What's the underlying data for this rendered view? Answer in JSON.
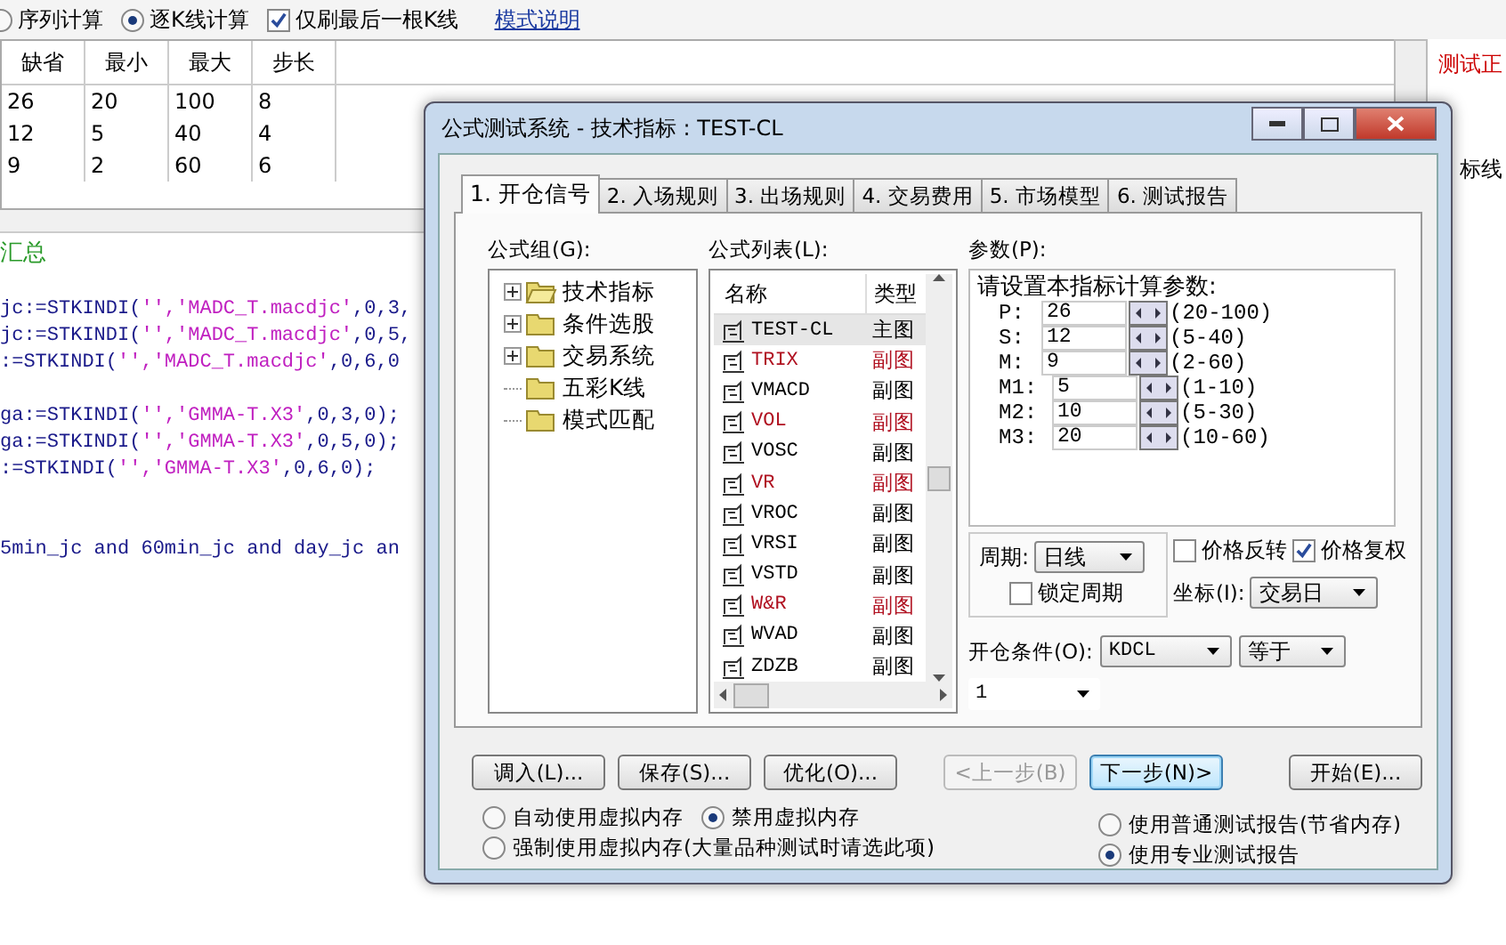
{
  "top_bar": {
    "modes": [
      {
        "label": "序列计算",
        "selected": false
      },
      {
        "label": "逐K线计算",
        "selected": true
      }
    ],
    "refresh_last": {
      "label": "仅刷最后一根K线",
      "checked": true
    },
    "link": "模式说明"
  },
  "param_table": {
    "columns": [
      "缺省",
      "最小",
      "最大",
      "步长"
    ],
    "rows": [
      [
        "26",
        "20",
        "100",
        "8"
      ],
      [
        "12",
        "5",
        "40",
        "4"
      ],
      [
        "9",
        "2",
        "60",
        "6"
      ]
    ]
  },
  "side_labels": [
    {
      "text": "测试正",
      "color": "#cc0000"
    },
    {
      "text": "标线",
      "color": "#000000"
    }
  ],
  "editor": {
    "heading": "汇总",
    "lines": [
      {
        "kind": "blank"
      },
      {
        "kind": "code",
        "parts": [
          {
            "kind": "code",
            "text": "jc:=STKINDI("
          },
          {
            "kind": "string",
            "text": "'','MADC_T.macdjc'"
          },
          {
            "kind": "code",
            "text": ",0,3,"
          }
        ]
      },
      {
        "kind": "code",
        "parts": [
          {
            "kind": "code",
            "text": "jc:=STKINDI("
          },
          {
            "kind": "string",
            "text": "'','MADC_T.macdjc'"
          },
          {
            "kind": "code",
            "text": ",0,5,"
          }
        ]
      },
      {
        "kind": "code",
        "parts": [
          {
            "kind": "code",
            "text": ":=STKINDI("
          },
          {
            "kind": "string",
            "text": "'','MADC_T.macdjc'"
          },
          {
            "kind": "code",
            "text": ",0,6,0"
          }
        ]
      },
      {
        "kind": "blank"
      },
      {
        "kind": "code",
        "parts": [
          {
            "kind": "code",
            "text": "ga:=STKINDI("
          },
          {
            "kind": "string",
            "text": "'','GMMA-T.X3'"
          },
          {
            "kind": "code",
            "text": ",0,3,0);"
          }
        ]
      },
      {
        "kind": "code",
        "parts": [
          {
            "kind": "code",
            "text": "ga:=STKINDI("
          },
          {
            "kind": "string",
            "text": "'','GMMA-T.X3'"
          },
          {
            "kind": "code",
            "text": ",0,5,0);"
          }
        ]
      },
      {
        "kind": "code",
        "parts": [
          {
            "kind": "code",
            "text": ":=STKINDI("
          },
          {
            "kind": "string",
            "text": "'','GMMA-T.X3'"
          },
          {
            "kind": "code",
            "text": ",0,6,0);"
          }
        ]
      },
      {
        "kind": "blank"
      },
      {
        "kind": "blank"
      },
      {
        "kind": "code",
        "parts": [
          {
            "kind": "code",
            "text": "5min_jc and 60min_jc and day_jc an"
          }
        ]
      }
    ]
  },
  "dialog": {
    "title": "公式测试系统 - 技术指标 : TEST-CL",
    "tabs": [
      {
        "label": "1. 开仓信号",
        "selected": true
      },
      {
        "label": "2. 入场规则",
        "selected": false
      },
      {
        "label": "3. 出场规则",
        "selected": false
      },
      {
        "label": "4. 交易费用",
        "selected": false
      },
      {
        "label": "5. 市场模型",
        "selected": false
      },
      {
        "label": "6. 测试报告",
        "selected": false
      }
    ],
    "group_label": "公式组(G):",
    "tree": [
      {
        "label": "技术指标",
        "expandable": true,
        "open": true
      },
      {
        "label": "条件选股",
        "expandable": true,
        "open": false
      },
      {
        "label": "交易系统",
        "expandable": true,
        "open": false
      },
      {
        "label": "五彩K线",
        "expandable": false,
        "open": false
      },
      {
        "label": "模式匹配",
        "expandable": false,
        "open": false
      }
    ],
    "list_label": "公式列表(L):",
    "list_columns": [
      "名称",
      "类型"
    ],
    "formulas": [
      {
        "name": "TEST-CL",
        "type": "主图",
        "color": "#000000",
        "selected": true
      },
      {
        "name": "TRIX",
        "type": "副图",
        "color": "#b01020",
        "selected": false
      },
      {
        "name": "VMACD",
        "type": "副图",
        "color": "#000000",
        "selected": false
      },
      {
        "name": "VOL",
        "type": "副图",
        "color": "#b01020",
        "selected": false
      },
      {
        "name": "VOSC",
        "type": "副图",
        "color": "#000000",
        "selected": false
      },
      {
        "name": "VR",
        "type": "副图",
        "color": "#b01020",
        "selected": false
      },
      {
        "name": "VROC",
        "type": "副图",
        "color": "#000000",
        "selected": false
      },
      {
        "name": "VRSI",
        "type": "副图",
        "color": "#000000",
        "selected": false
      },
      {
        "name": "VSTD",
        "type": "副图",
        "color": "#000000",
        "selected": false
      },
      {
        "name": "W&R",
        "type": "副图",
        "color": "#b01020",
        "selected": false
      },
      {
        "name": "WVAD",
        "type": "副图",
        "color": "#000000",
        "selected": false
      },
      {
        "name": "ZDZB",
        "type": "副图",
        "color": "#000000",
        "selected": false
      }
    ],
    "params_label": "参数(P):",
    "params_prompt": "请设置本指标计算参数:",
    "params": [
      {
        "name": "P:",
        "value": "26",
        "range": "(20-100)"
      },
      {
        "name": "S:",
        "value": "12",
        "range": "(5-40)"
      },
      {
        "name": "M:",
        "value": "9",
        "range": "(2-60)"
      },
      {
        "name": "M1:",
        "value": "5",
        "range": "(1-10)"
      },
      {
        "name": "M2:",
        "value": "10",
        "range": "(5-30)"
      },
      {
        "name": "M3:",
        "value": "20",
        "range": "(10-60)"
      }
    ],
    "period": {
      "label": "周期:",
      "value": "日线"
    },
    "lock_period": {
      "label": "锁定周期",
      "checked": false
    },
    "price_reverse": {
      "label": "价格反转",
      "checked": false
    },
    "price_adjust": {
      "label": "价格复权",
      "checked": true
    },
    "axis": {
      "label": "坐标(I):",
      "value": "交易日"
    },
    "open_condition": {
      "label": "开仓条件(O):",
      "value": "KDCL",
      "operator": "等于",
      "target": "1"
    },
    "buttons": [
      {
        "label": "调入(L)...",
        "disabled": false,
        "default": false
      },
      {
        "label": "保存(S)...",
        "disabled": false,
        "default": false
      },
      {
        "label": "优化(O)...",
        "disabled": false,
        "default": false
      },
      {
        "label": "<上一步(B)",
        "disabled": true,
        "default": false
      },
      {
        "label": "下一步(N)>",
        "disabled": false,
        "default": true
      },
      {
        "label": "开始(E)...",
        "disabled": false,
        "default": false
      }
    ],
    "memory_options": [
      {
        "label": "自动使用虚拟内存",
        "selected": false
      },
      {
        "label": "禁用虚拟内存",
        "selected": true
      },
      {
        "label": "强制使用虚拟内存(大量品种测试时请选此项)",
        "selected": false
      }
    ],
    "report_options": [
      {
        "label": "使用普通测试报告(节省内存)",
        "selected": false
      },
      {
        "label": "使用专业测试报告",
        "selected": true
      }
    ]
  }
}
